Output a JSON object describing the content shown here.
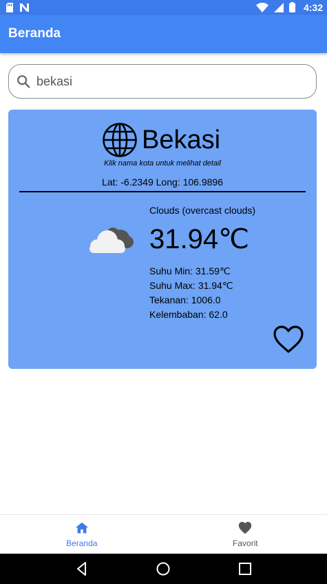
{
  "status_bar": {
    "time": "4:32",
    "icons": [
      "sd-card-icon",
      "n-notification-icon",
      "wifi-icon",
      "signal-icon",
      "battery-icon"
    ]
  },
  "app_bar": {
    "title": "Beranda"
  },
  "search": {
    "value": "bekasi",
    "icon": "search-icon"
  },
  "weather_card": {
    "city": "Bekasi",
    "hint": "Klik nama kota untuk melihat detail",
    "coords": "Lat: -6.2349 Long: 106.9896",
    "condition": "Clouds (overcast clouds)",
    "temperature": "31.94℃",
    "temp_min": "Suhu Min: 31.59℃",
    "temp_max": "Suhu Max: 31.94℃",
    "pressure": "Tekanan: 1006.0",
    "humidity": "Kelembaban: 62.0",
    "weather_icon": "cloud-icon",
    "background_color": "#6ea3f5"
  },
  "bottom_nav": {
    "items": [
      {
        "label": "Beranda",
        "icon": "home-icon",
        "active": true
      },
      {
        "label": "Favorit",
        "icon": "heart-icon",
        "active": false
      }
    ]
  },
  "colors": {
    "primary": "#4285f4",
    "status_bar": "#3d7bea",
    "card": "#6ea3f5"
  }
}
